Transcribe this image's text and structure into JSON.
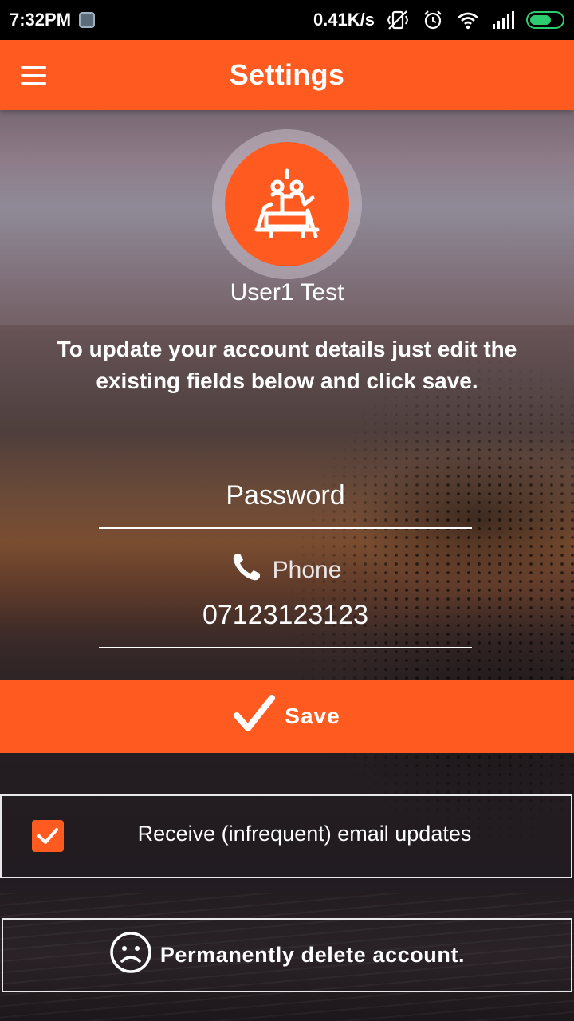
{
  "status_bar": {
    "time": "7:32PM",
    "network_speed": "0.41K/s",
    "icons": [
      "app-notification-icon",
      "vibrate-off-icon",
      "alarm-icon",
      "wifi-icon",
      "signal-icon",
      "battery-icon"
    ]
  },
  "app_bar": {
    "title": "Settings",
    "menu_icon": "hamburger-menu-icon",
    "color": "#ff5a1f"
  },
  "profile": {
    "name": "User1 Test",
    "avatar_icon": "people-at-table-icon"
  },
  "intro_text": "To update your account details just edit the existing fields below and click save.",
  "form": {
    "password_placeholder": "Password",
    "phone_label": "Phone",
    "phone_icon": "phone-icon",
    "phone_value": "07123123123"
  },
  "save": {
    "label": "Save",
    "icon": "checkmark-icon"
  },
  "email_updates": {
    "label": "Receive (infrequent) email updates",
    "checked": true
  },
  "delete_account": {
    "label": "Permanently delete account.",
    "icon": "sad-face-icon"
  },
  "colors": {
    "accent": "#ff5a1f",
    "status_bar_bg": "#000000",
    "battery": "#2ecc71"
  }
}
